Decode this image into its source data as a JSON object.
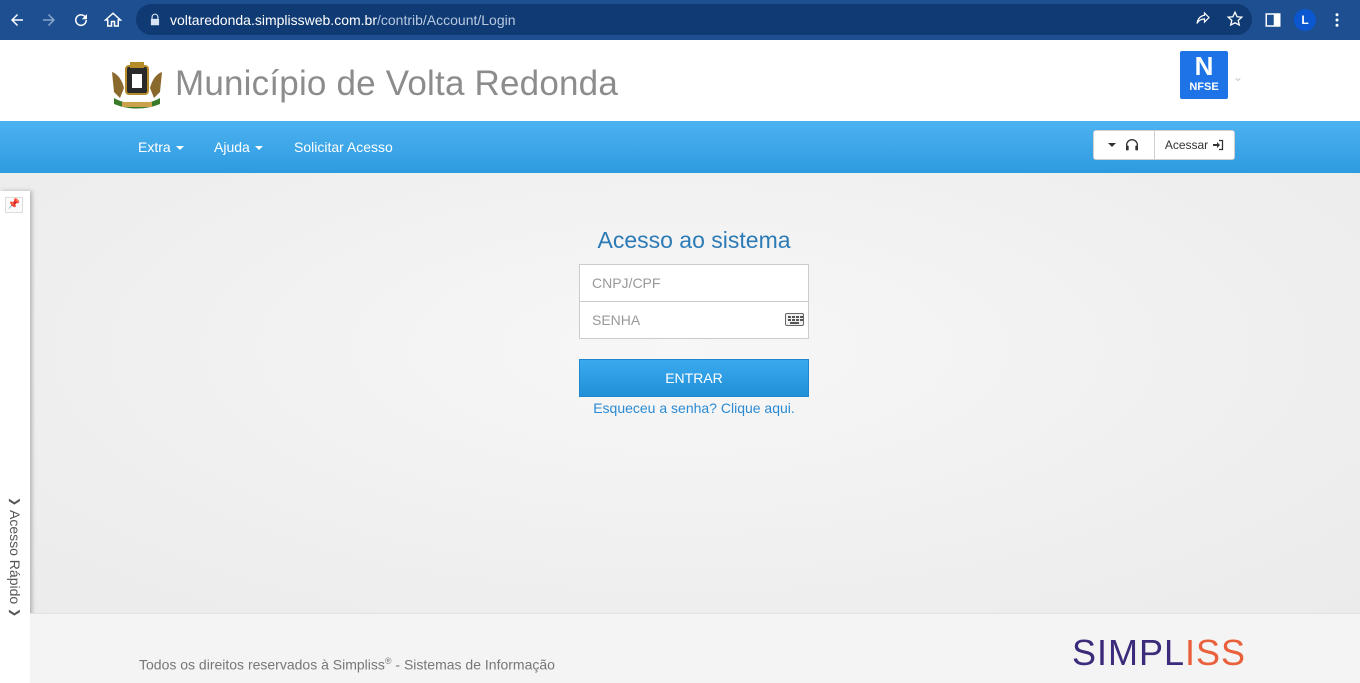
{
  "browser": {
    "url_host": "voltaredonda.simplissweb.com.br",
    "url_path": "/contrib/Account/Login",
    "profile_initial": "L"
  },
  "header": {
    "title": "Município de Volta Redonda",
    "badge_letter": "N",
    "badge_text": "NFSE",
    "accent_color": "#1e74e6"
  },
  "navbar": {
    "items": [
      {
        "label": "Extra"
      },
      {
        "label": "Ajuda"
      },
      {
        "label": "Solicitar Acesso"
      }
    ],
    "acessar_label": "Acessar",
    "color": "#3aa5e8"
  },
  "side_panel": {
    "label": "Acesso Rápido"
  },
  "login": {
    "title": "Acesso ao sistema",
    "cnpj_placeholder": "CNPJ/CPF",
    "senha_placeholder": "SENHA",
    "submit_label": "ENTRAR",
    "forgot_label": "Esqueceu a senha? Clique aqui."
  },
  "footer": {
    "copyright_prefix": "Todos os direitos reservados à Simpliss",
    "copyright_mark": "®",
    "copyright_suffix": " - Sistemas de Informação",
    "logo_part_a": "SIMPL",
    "logo_part_b": "ISS"
  }
}
